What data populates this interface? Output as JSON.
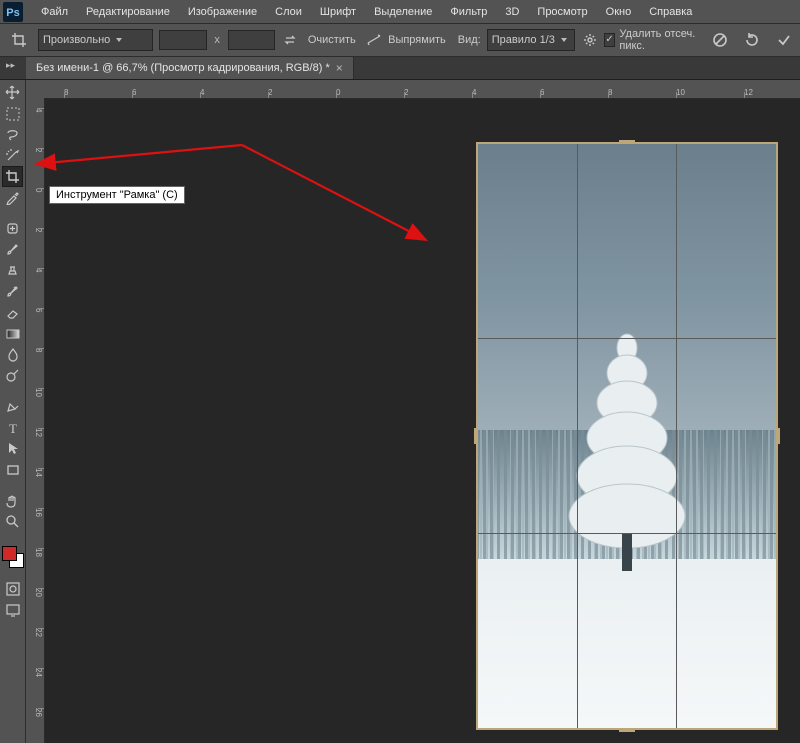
{
  "menubar": {
    "items": [
      "Файл",
      "Редактирование",
      "Изображение",
      "Слои",
      "Шрифт",
      "Выделение",
      "Фильтр",
      "3D",
      "Просмотр",
      "Окно",
      "Справка"
    ]
  },
  "optionsbar": {
    "ratio_label": "Произвольно",
    "sep": "x",
    "clear_label": "Очистить",
    "straighten_label": "Выпрямить",
    "view_label": "Вид:",
    "view_value": "Правило 1/3",
    "delete_cropped_label": "Удалить отсеч. пикс."
  },
  "tab": {
    "title": "Без имени-1 @ 66,7% (Просмотр кадрирования, RGB/8) *"
  },
  "ruler_h": [
    "8",
    "6",
    "4",
    "2",
    "0",
    "2",
    "4",
    "6",
    "8",
    "10",
    "12"
  ],
  "ruler_v": [
    "4",
    "2",
    "0",
    "2",
    "4",
    "6",
    "8",
    "10",
    "12",
    "14",
    "16",
    "18",
    "20",
    "22",
    "24",
    "26"
  ],
  "tooltip": "Инструмент \"Рамка\" (C)",
  "toolbox": {
    "tools": [
      {
        "name": "move-tool",
        "title": "Move"
      },
      {
        "name": "marquee-tool",
        "title": "Rectangular Marquee"
      },
      {
        "name": "lasso-tool",
        "title": "Lasso"
      },
      {
        "name": "magic-wand-tool",
        "title": "Magic Wand"
      },
      {
        "name": "crop-tool",
        "title": "Crop",
        "selected": true
      },
      {
        "name": "eyedropper-tool",
        "title": "Eyedropper"
      },
      {
        "name": "healing-brush-tool",
        "title": "Healing Brush"
      },
      {
        "name": "brush-tool",
        "title": "Brush"
      },
      {
        "name": "clone-stamp-tool",
        "title": "Clone Stamp"
      },
      {
        "name": "history-brush-tool",
        "title": "History Brush"
      },
      {
        "name": "eraser-tool",
        "title": "Eraser"
      },
      {
        "name": "gradient-tool",
        "title": "Gradient"
      },
      {
        "name": "blur-tool",
        "title": "Blur"
      },
      {
        "name": "dodge-tool",
        "title": "Dodge"
      },
      {
        "name": "pen-tool",
        "title": "Pen"
      },
      {
        "name": "type-tool",
        "title": "Type"
      },
      {
        "name": "path-select-tool",
        "title": "Path Selection"
      },
      {
        "name": "rectangle-tool",
        "title": "Rectangle"
      },
      {
        "name": "hand-tool",
        "title": "Hand"
      },
      {
        "name": "zoom-tool",
        "title": "Zoom"
      }
    ],
    "fg_color": "#cf2a2a",
    "bg_color": "#ffffff"
  }
}
